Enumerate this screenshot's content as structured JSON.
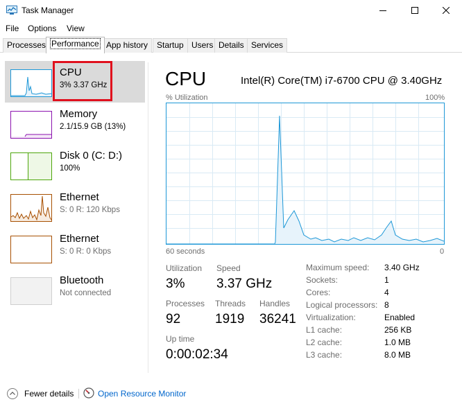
{
  "window": {
    "title": "Task Manager"
  },
  "menu": [
    "File",
    "Options",
    "View"
  ],
  "tabs": [
    "Processes",
    "Performance",
    "App history",
    "Startup",
    "Users",
    "Details",
    "Services"
  ],
  "active_tab": "Performance",
  "sidebar": [
    {
      "name": "CPU",
      "sub": "3%  3.37 GHz",
      "color": "#1c97d7"
    },
    {
      "name": "Memory",
      "sub": "2.1/15.9 GB (13%)",
      "color": "#8b12ae"
    },
    {
      "name": "Disk 0 (C: D:)",
      "sub": "100%",
      "color": "#4da60c"
    },
    {
      "name": "Ethernet",
      "sub": "S: 0 R: 120 Kbps",
      "color": "#a74f01"
    },
    {
      "name": "Ethernet",
      "sub": "S: 0 R: 0 Kbps",
      "color": "#a74f01"
    },
    {
      "name": "Bluetooth",
      "sub": "Not connected",
      "color": "#999999"
    }
  ],
  "main": {
    "title": "CPU",
    "model": "Intel(R) Core(TM) i7-6700 CPU @ 3.40GHz",
    "graph": {
      "ylabel": "% Utilization",
      "ymax_label": "100%",
      "xlabel_left": "60 seconds",
      "xlabel_right": "0",
      "accent": "#1c97d7"
    },
    "stats": {
      "utilization_label": "Utilization",
      "utilization": "3%",
      "speed_label": "Speed",
      "speed": "3.37 GHz",
      "processes_label": "Processes",
      "processes": "92",
      "threads_label": "Threads",
      "threads": "1919",
      "handles_label": "Handles",
      "handles": "36241",
      "uptime_label": "Up time",
      "uptime": "0:00:02:34"
    },
    "details": [
      {
        "label": "Maximum speed:",
        "value": "3.40 GHz"
      },
      {
        "label": "Sockets:",
        "value": "1"
      },
      {
        "label": "Cores:",
        "value": "4"
      },
      {
        "label": "Logical processors:",
        "value": "8"
      },
      {
        "label": "Virtualization:",
        "value": "Enabled"
      },
      {
        "label": "L1 cache:",
        "value": "256 KB"
      },
      {
        "label": "L2 cache:",
        "value": "1.0 MB"
      },
      {
        "label": "L3 cache:",
        "value": "8.0 MB"
      }
    ]
  },
  "footer": {
    "fewer": "Fewer details",
    "resource_monitor": "Open Resource Monitor"
  }
}
